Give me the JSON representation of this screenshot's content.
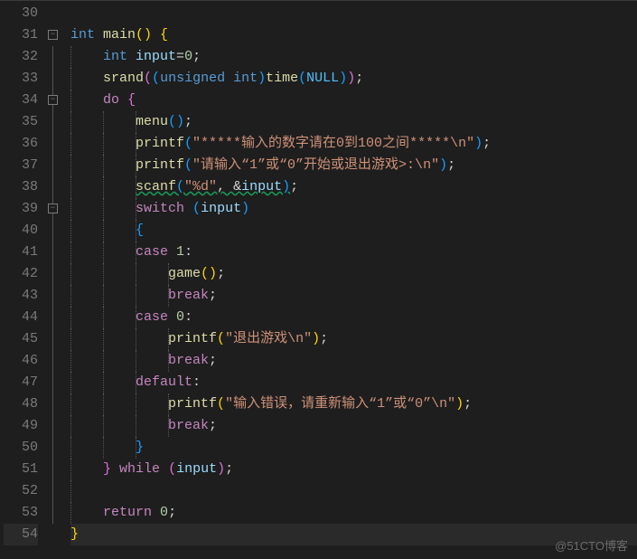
{
  "watermark": "@51CTO博客",
  "line_numbers": [
    "30",
    "31",
    "32",
    "33",
    "34",
    "35",
    "36",
    "37",
    "38",
    "39",
    "40",
    "41",
    "42",
    "43",
    "44",
    "45",
    "46",
    "47",
    "48",
    "49",
    "50",
    "51",
    "52",
    "53",
    "54"
  ],
  "fold_minus": "−",
  "code": {
    "l31_int": "int",
    "l31_main": " main",
    "l31_paren": "()",
    "l31_brace": " {",
    "l32_int": "int",
    "l32_var": " input",
    "l32_eq": "=",
    "l32_num": "0",
    "l32_semi": ";",
    "l33_srand": "srand",
    "l33_open": "(",
    "l33_cast_open": "(",
    "l33_unsigned": "unsigned",
    "l33_sp1": " ",
    "l33_inttype": "int",
    "l33_cast_close": ")",
    "l33_time": "time",
    "l33_t_open": "(",
    "l33_null": "NULL",
    "l33_t_close": ")",
    "l33_close": ")",
    "l33_semi": ";",
    "l34_do": "do",
    "l34_brace": " {",
    "l35_menu": "menu",
    "l35_paren": "()",
    "l35_semi": ";",
    "l36_printf": "printf",
    "l36_open": "(",
    "l36_str": "\"*****输入的数字请在0到100之间*****\\n\"",
    "l36_close": ")",
    "l36_semi": ";",
    "l37_printf": "printf",
    "l37_open": "(",
    "l37_str": "\"请输入“1”或“0”开始或退出游戏>:\\n\"",
    "l37_close": ")",
    "l37_semi": ";",
    "l38_scanf": "scanf",
    "l38_open": "(",
    "l38_str": "\"%d\"",
    "l38_comma": ", ",
    "l38_amp": "&",
    "l38_input": "input",
    "l38_close": ")",
    "l38_semi": ";",
    "l39_switch": "switch",
    "l39_sp": " ",
    "l39_open": "(",
    "l39_input": "input",
    "l39_close": ")",
    "l40_brace": "{",
    "l41_case": "case",
    "l41_sp": " ",
    "l41_num": "1",
    "l41_colon": ":",
    "l42_game": "game",
    "l42_paren": "()",
    "l42_semi": ";",
    "l43_break": "break",
    "l43_semi": ";",
    "l44_case": "case",
    "l44_sp": " ",
    "l44_num": "0",
    "l44_colon": ":",
    "l45_printf": "printf",
    "l45_open": "(",
    "l45_str": "\"退出游戏\\n\"",
    "l45_close": ")",
    "l45_semi": ";",
    "l46_break": "break",
    "l46_semi": ";",
    "l47_default": "default",
    "l47_colon": ":",
    "l48_printf": "printf",
    "l48_open": "(",
    "l48_str": "\"输入错误，请重新输入“1”或“0”\\n\"",
    "l48_close": ")",
    "l48_semi": ";",
    "l49_break": "break",
    "l49_semi": ";",
    "l50_brace": "}",
    "l51_brace": "}",
    "l51_sp": " ",
    "l51_while": "while",
    "l51_sp2": " ",
    "l51_open": "(",
    "l51_input": "input",
    "l51_close": ")",
    "l51_semi": ";",
    "l53_return": "return",
    "l53_sp": " ",
    "l53_num": "0",
    "l53_semi": ";",
    "l54_brace": "}"
  }
}
